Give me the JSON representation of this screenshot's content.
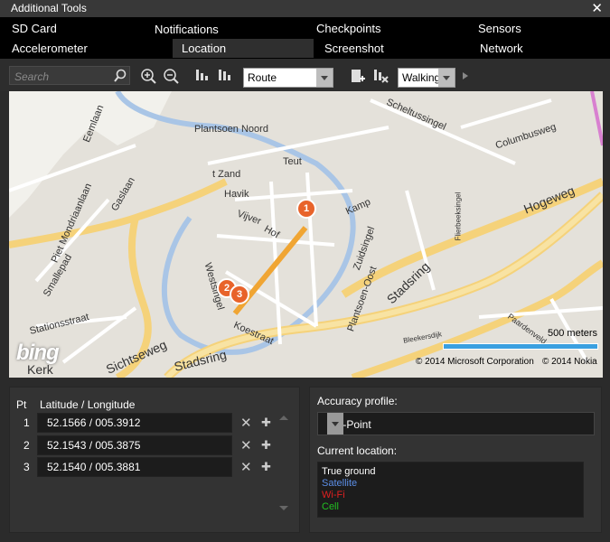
{
  "window": {
    "title": "Additional Tools"
  },
  "tabs": {
    "row1": [
      "SD Card",
      "Notifications",
      "Checkpoints",
      "Sensors"
    ],
    "row2": [
      "Accelerometer",
      "Location",
      "Screenshot",
      "Network"
    ],
    "active": "Location"
  },
  "toolbar": {
    "search_placeholder": "Search",
    "mode_value": "Route",
    "travel_value": "Walking"
  },
  "map": {
    "labels": [
      "Plantsoen Noord",
      "Scheltussingel",
      "Columbusweg",
      "Teut",
      "t Zand",
      "Havik",
      "Vijver",
      "Hof",
      "Kamp",
      "Hogeweg",
      "Eemlaan",
      "Gaslaan",
      "Piet Mondriaanlaan",
      "Smallepad",
      "Stationsstraat",
      "Westsingel",
      "Plantsoen-Oost",
      "Zuidsingel",
      "Stadsring",
      "Koestraat",
      "Flierbeeksingel",
      "Paardenveld",
      "Bleekersdijk",
      "Stadsring",
      "Kerk",
      "Sichtseweg"
    ],
    "scale_label": "500 meters",
    "copyright_ms": "© 2014 Microsoft Corporation",
    "copyright_nokia": "© 2014 Nokia",
    "logo": "bing",
    "pins": [
      "1",
      "2",
      "3"
    ],
    "route_color": "#f0a533",
    "pin_color": "#e8632a"
  },
  "points": {
    "col_pt": "Pt",
    "col_latlon": "Latitude / Longitude",
    "rows": [
      {
        "num": "1",
        "value": "52.1566 /  005.3912"
      },
      {
        "num": "2",
        "value": "52.1543 /  005.3875"
      },
      {
        "num": "3",
        "value": "52.1540 /  005.3881"
      }
    ]
  },
  "accuracy": {
    "label": "Accuracy profile:",
    "value": "Pin-Point",
    "current_label": "Current location:",
    "sources": [
      {
        "text": "True ground",
        "color": "#ffffff"
      },
      {
        "text": "Satellite",
        "color": "#5b8ee6"
      },
      {
        "text": "Wi-Fi",
        "color": "#e02020"
      },
      {
        "text": "Cell",
        "color": "#22c022"
      }
    ]
  }
}
